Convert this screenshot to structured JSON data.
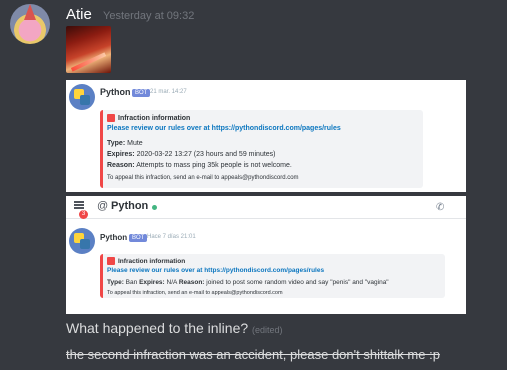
{
  "message": {
    "username": "Atie",
    "timestamp": "Yesterday at 09:32",
    "line1": "What happened to the inline?",
    "edited": "(edited)",
    "line2": "the second infraction was an accident, please don't shittalk me :p"
  },
  "screenshot1": {
    "bot_name": "Python",
    "bot_tag": "BOT",
    "time": "21 mar. 14:27",
    "embed": {
      "title": "Infraction information",
      "link": "Please review our rules over at https://pythondiscord.com/pages/rules",
      "type_label": "Type:",
      "type_value": "Mute",
      "expires_label": "Expires:",
      "expires_value": "2020-03-22 13:27 (23 hours and 59 minutes)",
      "reason_label": "Reason:",
      "reason_value": "Attempts to mass ping 35k people is not welcome.",
      "footer": "To appeal this infraction, send an e-mail to appeals@pythondiscord.com"
    }
  },
  "screenshot2": {
    "channel_at": "@",
    "channel_name": "Python",
    "mention_count": "3",
    "bot_name": "Python",
    "bot_tag": "BOT",
    "time": "Hace 7 días 21:01",
    "embed": {
      "title": "Infraction information",
      "link": "Please review our rules over at https://pythondiscord.com/pages/rules",
      "type_label": "Type:",
      "type_value": "Ban",
      "expires_label": "Expires:",
      "expires_value": "N/A",
      "reason_label": "Reason:",
      "reason_value": "joined to post some random video and say \"penis\" and \"vagina\"",
      "footer": "To appeal this infraction, send an e-mail to appeals@pythondiscord.com"
    }
  },
  "colors": {
    "background": "#36393f",
    "link": "#0b76bf",
    "infraction_red": "#f04747",
    "bot_tag": "#7289da",
    "online": "#43b581"
  },
  "icons": [
    "avatar-patrick",
    "python-logo-icon",
    "infraction-icon",
    "hamburger-menu-icon",
    "phone-icon"
  ]
}
